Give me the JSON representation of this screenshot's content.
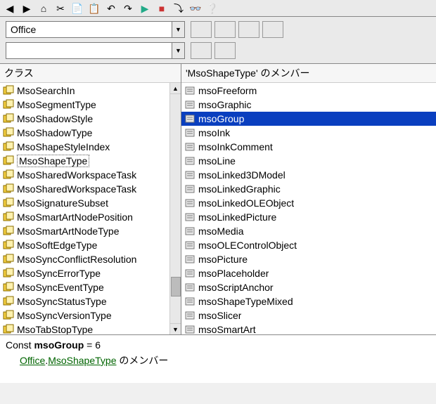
{
  "toolbar": {
    "buttons": [
      "back",
      "forward",
      "home",
      "cut",
      "copy",
      "paste",
      "undo",
      "redo",
      "run",
      "stop",
      "step",
      "out",
      "watch",
      "help"
    ]
  },
  "combos": {
    "library": {
      "value": "Office"
    },
    "search": {
      "value": ""
    },
    "small_buttons_row1": 4,
    "small_buttons_row2": 2
  },
  "classes": {
    "header": "クラス",
    "items": [
      "MsoSearchIn",
      "MsoSegmentType",
      "MsoShadowStyle",
      "MsoShadowType",
      "MsoShapeStyleIndex",
      "MsoShapeType",
      "MsoSharedWorkspaceTask",
      "MsoSharedWorkspaceTask",
      "MsoSignatureSubset",
      "MsoSmartArtNodePosition",
      "MsoSmartArtNodeType",
      "MsoSoftEdgeType",
      "MsoSyncConflictResolution",
      "MsoSyncErrorType",
      "MsoSyncEventType",
      "MsoSyncStatusType",
      "MsoSyncVersionType",
      "MsoTabStopType"
    ],
    "selected_index": 5
  },
  "members": {
    "header": "'MsoShapeType' のメンバー",
    "items": [
      "msoFreeform",
      "msoGraphic",
      "msoGroup",
      "msoInk",
      "msoInkComment",
      "msoLine",
      "msoLinked3DModel",
      "msoLinkedGraphic",
      "msoLinkedOLEObject",
      "msoLinkedPicture",
      "msoMedia",
      "msoOLEControlObject",
      "msoPicture",
      "msoPlaceholder",
      "msoScriptAnchor",
      "msoShapeTypeMixed",
      "msoSlicer",
      "msoSmartArt"
    ],
    "highlighted_index": 2
  },
  "detail": {
    "prefix": "Const ",
    "name": "msoGroup",
    "value": " = 6",
    "link1": "Office",
    "sep": ".",
    "link2": "MsoShapeType",
    "suffix": " のメンバー"
  }
}
